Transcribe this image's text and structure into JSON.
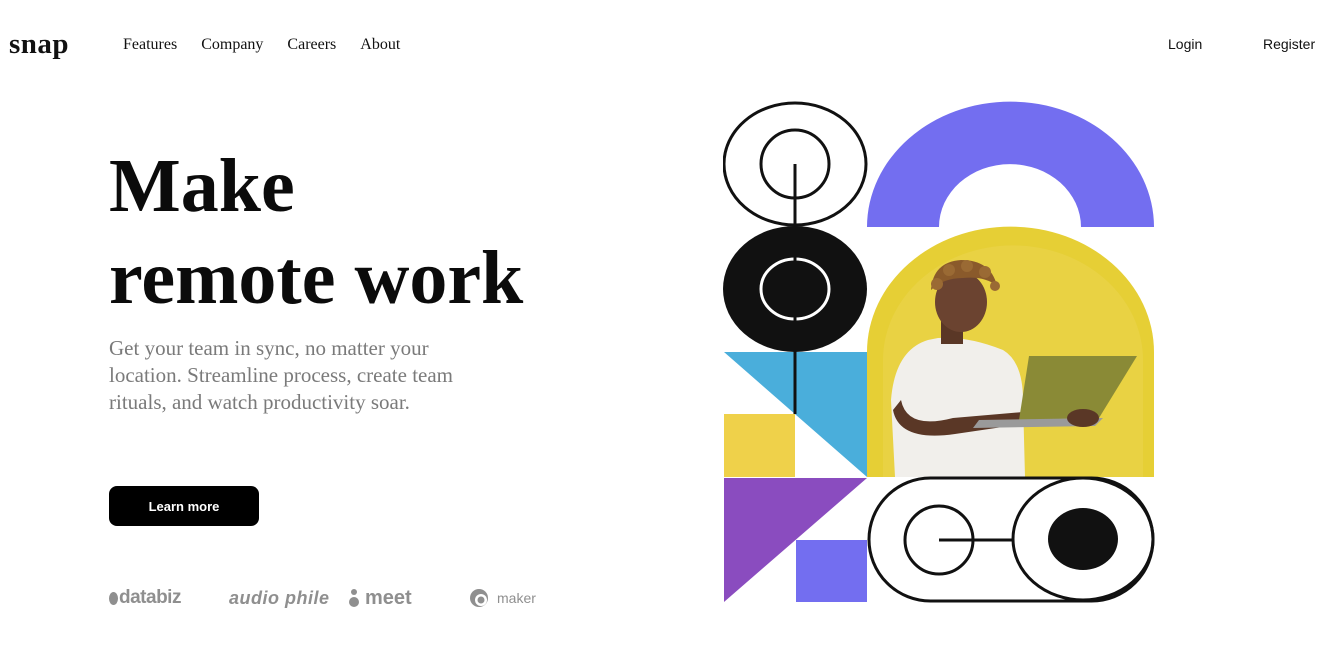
{
  "brand": {
    "logo": "snap"
  },
  "nav": {
    "items": [
      "Features",
      "Company",
      "Careers",
      "About"
    ]
  },
  "auth": {
    "login": "Login",
    "register": "Register"
  },
  "hero": {
    "headline_line1": "Make",
    "headline_line2": "remote work",
    "subtext": "Get your team in sync, no matter your location. Streamline process, create team rituals, and watch productivity soar.",
    "cta_label": "Learn more"
  },
  "clients": {
    "databiz": "databiz",
    "audiophile": "audio phile",
    "meet": "meet",
    "maker": "maker"
  },
  "colors": {
    "black": "#111111",
    "purple": "#736ef0",
    "yellow": "#e6cf35",
    "blue": "#4aaedb",
    "violet": "#8a4cbf",
    "gray": "#7a7a7a"
  }
}
